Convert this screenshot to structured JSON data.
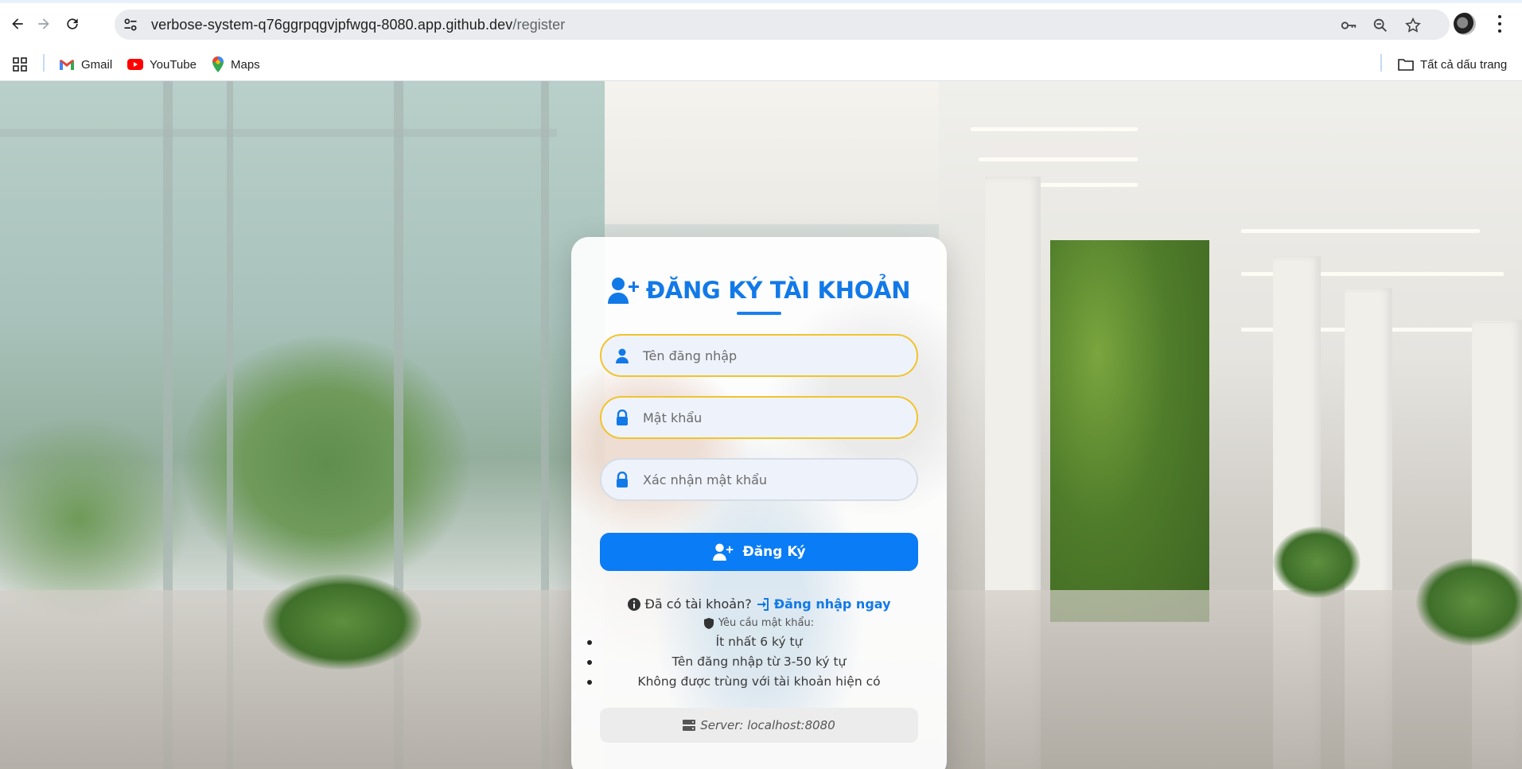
{
  "browser": {
    "url_host": "verbose-system-q76ggrpqgvjpfwgq-8080.app.github.dev",
    "url_path": "/register",
    "bookmarks": [
      {
        "label": "Gmail"
      },
      {
        "label": "YouTube"
      },
      {
        "label": "Maps"
      }
    ],
    "all_bookmarks_label": "Tất cả dấu trang"
  },
  "register": {
    "title": "ĐĂNG KÝ TÀI KHOẢN",
    "username_placeholder": "Tên đăng nhập",
    "password_placeholder": "Mật khẩu",
    "confirm_placeholder": "Xác nhận mật khẩu",
    "submit_label": "Đăng Ký",
    "have_account_text": "Đã có tài khoản?",
    "login_link_label": "Đăng nhập ngay",
    "requirements_title": "Yêu cầu mật khẩu:",
    "requirements": [
      "Ít nhất 6 ký tự",
      "Tên đăng nhập từ 3-50 ký tự",
      "Không được trùng với tài khoản hiện có"
    ],
    "server_text": "Server: localhost:8080"
  },
  "colors": {
    "accent": "#1279e8",
    "button": "#0a7cf5",
    "focus_border": "#f2c32c"
  }
}
